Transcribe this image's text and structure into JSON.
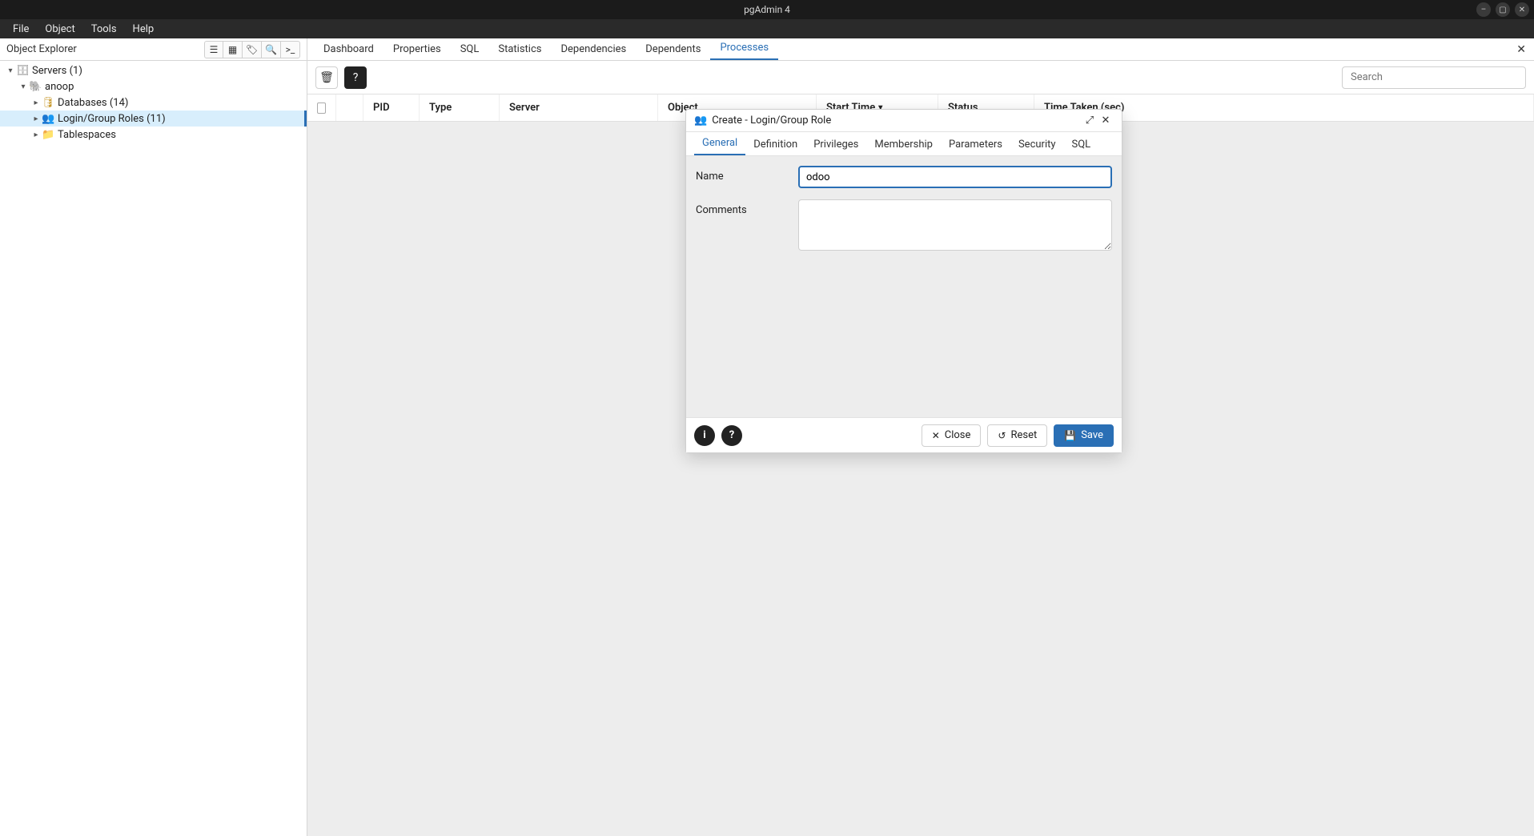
{
  "app_title": "pgAdmin 4",
  "menubar": [
    "File",
    "Object",
    "Tools",
    "Help"
  ],
  "explorer": {
    "title": "Object Explorer",
    "tree": {
      "servers": {
        "label": "Servers (1)"
      },
      "connection": {
        "label": "anoop"
      },
      "databases": {
        "label": "Databases (14)"
      },
      "roles": {
        "label": "Login/Group Roles (11)"
      },
      "tablespaces": {
        "label": "Tablespaces"
      }
    }
  },
  "tabs": [
    "Dashboard",
    "Properties",
    "SQL",
    "Statistics",
    "Dependencies",
    "Dependents",
    "Processes"
  ],
  "active_tab": "Processes",
  "search_placeholder": "Search",
  "table_columns": {
    "pid": "PID",
    "type": "Type",
    "server": "Server",
    "object": "Object",
    "start": "Start Time",
    "status": "Status",
    "timetaken": "Time Taken (sec)"
  },
  "modal": {
    "title": "Create - Login/Group Role",
    "tabs": [
      "General",
      "Definition",
      "Privileges",
      "Membership",
      "Parameters",
      "Security",
      "SQL"
    ],
    "active_tab": "General",
    "fields": {
      "name_label": "Name",
      "name_value": "odoo",
      "comments_label": "Comments",
      "comments_value": ""
    },
    "buttons": {
      "close": "Close",
      "reset": "Reset",
      "save": "Save"
    }
  }
}
